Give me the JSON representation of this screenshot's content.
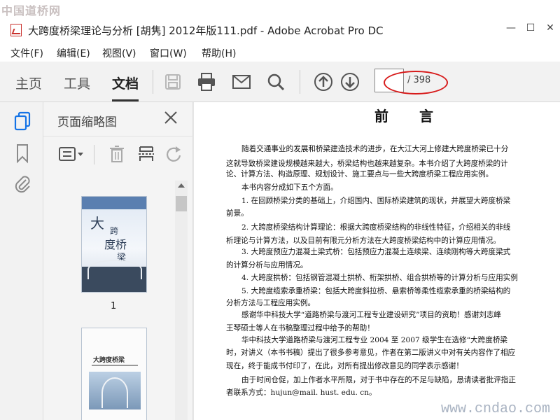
{
  "watermarks": {
    "top": "中国道桥网",
    "bottom": "www.cndao.com"
  },
  "window": {
    "title": "大跨度桥梁理论与分析 [胡隽] 2012年版111.pdf - Adobe Acrobat Pro DC",
    "min_glyph": "—",
    "max_glyph": "☐",
    "close_glyph": "✕"
  },
  "menu": [
    "文件(F)",
    "编辑(E)",
    "视图(V)",
    "窗口(W)",
    "帮助(H)"
  ],
  "tabs": [
    {
      "label": "主页",
      "active": false
    },
    {
      "label": "工具",
      "active": false
    },
    {
      "label": "文档",
      "active": true
    }
  ],
  "toolbar": {
    "icons": [
      "save-icon",
      "print-icon",
      "email-icon",
      "search-icon",
      "page-up-icon",
      "page-down-icon"
    ],
    "page_input": "",
    "page_total": "/ 398"
  },
  "left_rail": {
    "icons": [
      "thumbnails-icon",
      "bookmark-icon",
      "attachment-icon"
    ],
    "accent": "#1473e6"
  },
  "thumbnail_panel": {
    "title": "页面缩略图",
    "tools": [
      "thumbnail-options-icon",
      "delete-page-icon",
      "extract-page-icon",
      "rotate-page-icon"
    ],
    "pages": [
      {
        "number": "1",
        "cover_text": [
          "大",
          "跨",
          "度桥",
          "梁"
        ]
      },
      {
        "number": "",
        "cover_text": [
          "大跨度桥梁"
        ]
      }
    ]
  },
  "document": {
    "heading": "前言",
    "lines": [
      "随着交通事业的发展和桥梁建造技术的进步，在大江大河上修建大跨度桥梁已十分",
      "这就导致桥梁建设规模越来越大，桥梁结构也越来越复杂。本书介绍了大跨度桥梁的计",
      "论、计算方法、构造原理、规划设计、施工要点与一些大跨度桥梁工程应用实例。",
      "本书内容分成如下五个方面。",
      "1. 在回顾桥梁分类的基础上，介绍国内、国际桥梁建筑的现状，并展望大跨度桥梁",
      "前景。",
      "2. 大跨度桥梁结构计算理论：根据大跨度桥梁结构的非线性特征，介绍相关的非线",
      "析理论与计算方法，以及目前有限元分析方法在大跨度桥梁结构中的计算应用情况。",
      "3. 大跨度预应力混凝土梁式桥：包括预应力混凝土连续梁、连续刚构等大跨度梁式",
      "的计算分析与应用情况。",
      "4. 大跨度拱桥：包括钢管混凝土拱桥、桁架拱桥、组合拱桥等的计算分析与应用实例",
      "5. 大跨度缆索承重桥梁：包括大跨度斜拉桥、悬索桥等柔性缆索承重的桥梁结构的",
      "分析方法与工程应用实例。",
      "感谢华中科技大学“道路桥梁与渡河工程专业建设研究”项目的资助！感谢刘志峰",
      "王琴硕士等人在书稿整理过程中给予的帮助！",
      "华中科技大学道路桥梁与渡河工程专业 2004 至 2007 级学生在选修“大跨度桥梁",
      "时，对讲义（本书书稿）提出了很多参考意见，作者在第二版讲义中对有关内容作了相应",
      "现在，终于能成书付印了，在此，对所有提出修改意见的同学表示感谢！",
      "由于时间仓促，加上作者水平所限，对于书中存在的不足与缺陷，恳请读者批评指正",
      "者联系方式：hujun@mail. hust. edu. cn。"
    ]
  },
  "annotation_color": "#d71b1b"
}
